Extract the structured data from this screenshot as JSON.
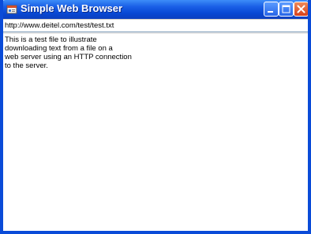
{
  "window": {
    "title": "Simple Web Browser"
  },
  "titlebar_icons": {
    "app_icon": "browser-window-icon",
    "minimize": "minimize-icon",
    "maximize": "maximize-icon",
    "close": "close-icon"
  },
  "address_bar": {
    "value": "http://www.deitel.com/test/test.txt"
  },
  "content": {
    "lines": [
      "This is a test file to illustrate",
      "downloading text from a file on a",
      "web server using an HTTP connection",
      "to the server."
    ]
  },
  "colors": {
    "titlebar": "#0848d4",
    "close_button": "#d8411b",
    "window_border": "#0a4bd8"
  }
}
